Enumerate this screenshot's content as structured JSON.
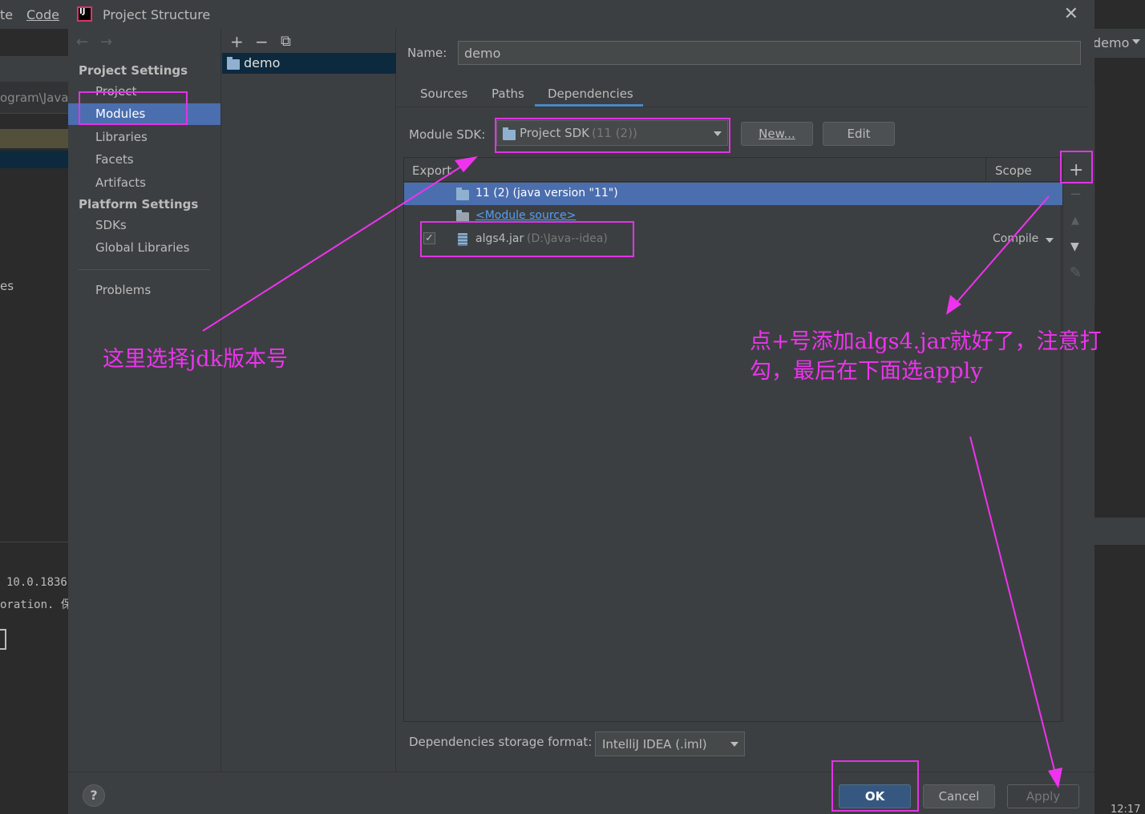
{
  "background": {
    "menu_ite": "te",
    "menu_code": "Code",
    "path_fragment": "ogram\\Java",
    "es_fragment": "es",
    "terminal_line1": "10.0.1836",
    "terminal_line2": "oration. 保",
    "right_run_config": "demo",
    "clock": "12:17"
  },
  "dialog": {
    "title": "Project Structure",
    "close": "✕"
  },
  "sidebar": {
    "back": "←",
    "forward": "→",
    "project_settings": "Project Settings",
    "items": [
      {
        "label": "Project"
      },
      {
        "label": "Modules"
      },
      {
        "label": "Libraries"
      },
      {
        "label": "Facets"
      },
      {
        "label": "Artifacts"
      }
    ],
    "platform_settings": "Platform Settings",
    "platform_items": [
      {
        "label": "SDKs"
      },
      {
        "label": "Global Libraries"
      }
    ],
    "problems": "Problems"
  },
  "modules_panel": {
    "add": "+",
    "remove": "−",
    "copy": "⧉",
    "module": "demo"
  },
  "module": {
    "name_label": "Name:",
    "name_value": "demo",
    "tabs": [
      "Sources",
      "Paths",
      "Dependencies"
    ],
    "sdk_label": "Module SDK:",
    "sdk_value": "Project SDK",
    "sdk_version": "(11 (2))",
    "new_button": "New...",
    "edit_button": "Edit",
    "table": {
      "header_export": "Export",
      "header_scope": "Scope",
      "rows": [
        {
          "label": "11 (2) (java version \"11\")"
        },
        {
          "label": "<Module source>"
        },
        {
          "label": "algs4.jar",
          "path": "(D:\\Java--idea)",
          "scope": "Compile",
          "checked": "✓"
        }
      ]
    },
    "side_add": "+",
    "side_remove": "−",
    "side_up": "▲",
    "side_down": "▼",
    "side_edit": "✎",
    "storage_label": "Dependencies storage format:",
    "storage_value": "IntelliJ IDEA (.iml)"
  },
  "buttons": {
    "help": "?",
    "ok": "OK",
    "cancel": "Cancel",
    "apply": "Apply"
  },
  "annotations": {
    "jdk_note": "这里选择jdk版本号",
    "add_note_line1": "点+号添加algs4.jar就好了，注意打",
    "add_note_line2": "勾，最后在下面选apply",
    "color": "#ee33ee"
  }
}
